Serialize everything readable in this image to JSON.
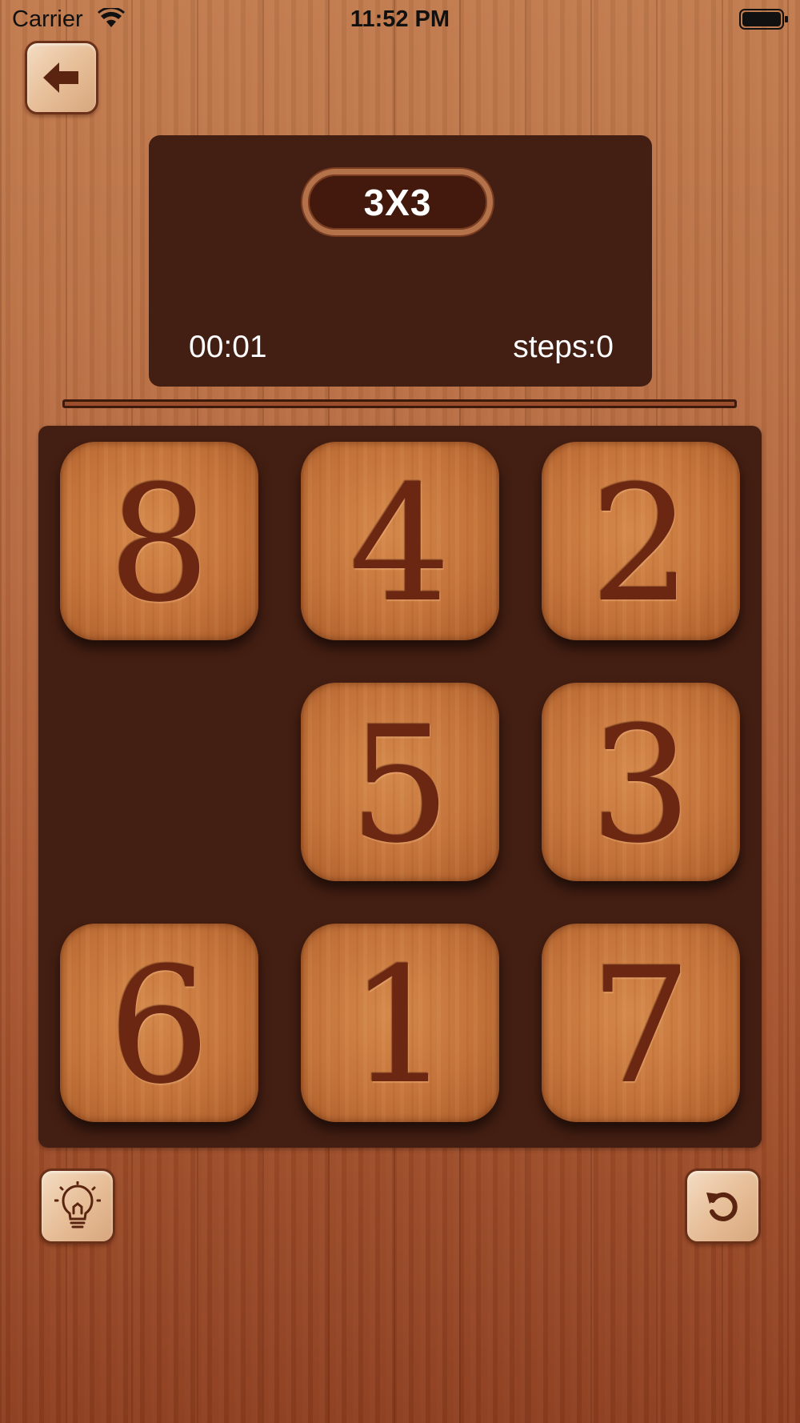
{
  "status_bar": {
    "carrier": "Carrier",
    "time": "11:52 PM"
  },
  "game": {
    "level": "3X3",
    "timer": "00:01",
    "steps": "steps:0"
  },
  "board": {
    "rows": 3,
    "cols": 3,
    "tiles": [
      "8",
      "4",
      "2",
      "",
      "5",
      "3",
      "6",
      "1",
      "7"
    ]
  },
  "colors": {
    "panel": "#431e12",
    "tile_text": "#6b2712",
    "badge_border": "#b4724b"
  },
  "icons": {
    "back": "arrow-left-icon",
    "hint": "lightbulb-icon",
    "reset": "rotate-icon"
  }
}
